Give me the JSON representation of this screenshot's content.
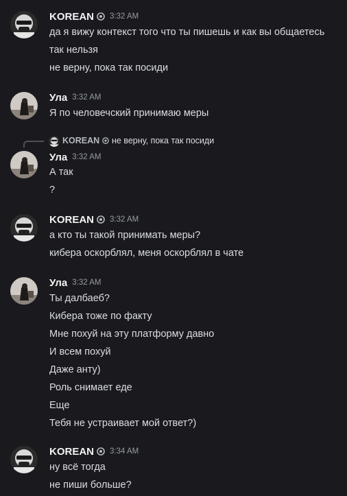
{
  "messages": [
    {
      "author": "KOREAN",
      "time": "3:32 AM",
      "lines": [
        "да я вижу контекст того что ты пишешь и как вы общаетесь",
        "так нельзя",
        "не верну, пока так посиди"
      ]
    },
    {
      "author": "Ула",
      "time": "3:32 AM",
      "lines": [
        "Я по человечский принимаю меры"
      ]
    },
    {
      "reply": {
        "author": "KOREAN",
        "text": "не верну, пока так посиди"
      },
      "author": "Ула",
      "time": "3:32 AM",
      "lines": [
        "А так",
        "?"
      ]
    },
    {
      "author": "KOREAN",
      "time": "3:32 AM",
      "lines": [
        "а кто ты такой принимать меры?",
        "кибера оскорблял, меня оскорблял в чате"
      ]
    },
    {
      "author": "Ула",
      "time": "3:32 AM",
      "lines": [
        "Ты далбаеб?",
        "Кибера тоже по факту",
        "Мне похуй на эту платформу давно",
        "И всем похуй",
        "Даже анту)",
        "Роль снимает еде",
        "Еще",
        "Тебя не устраивает мой ответ?)"
      ]
    },
    {
      "author": "KOREAN",
      "time": "3:34 AM",
      "lines": [
        "ну всё тогда",
        "не пиши больше?"
      ]
    }
  ],
  "colors": {
    "background": "#1a1a1e",
    "username": "#f2f3f5",
    "timestamp": "#949ba4",
    "text": "#dbdee1",
    "reply_spine": "#4e5058"
  },
  "icons": {
    "korean_badge": "server-tag-badge-icon",
    "korean_avatar": "masked-face-avatar",
    "ula_avatar": "dark-figure-avatar"
  }
}
